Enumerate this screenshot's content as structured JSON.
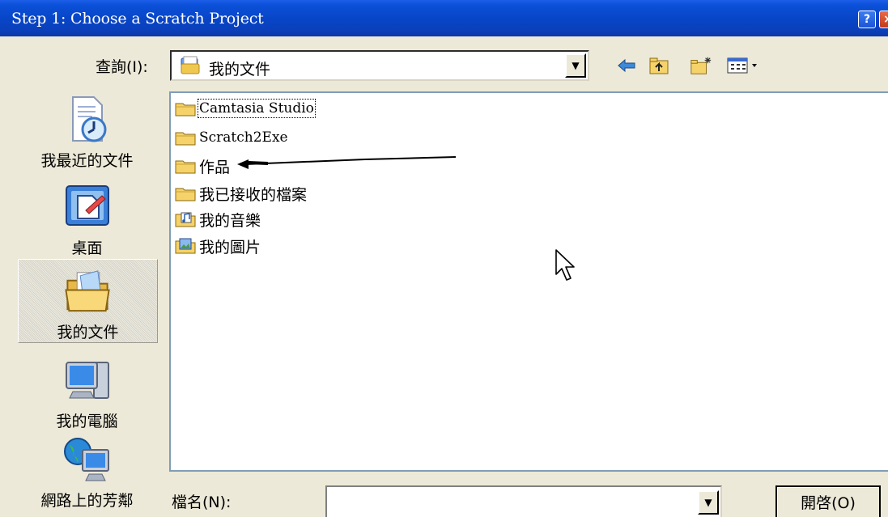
{
  "window": {
    "title": "Step 1: Choose a Scratch Project",
    "help_label": "?",
    "close_label": "×"
  },
  "lookin": {
    "label": "查詢(I):",
    "value": "我的文件",
    "icons": [
      "back-icon",
      "up-folder-icon",
      "new-folder-icon",
      "view-menu-icon"
    ]
  },
  "places": [
    {
      "label": "我最近的文件",
      "icon": "recent-documents-icon"
    },
    {
      "label": "桌面",
      "icon": "desktop-icon"
    },
    {
      "label": "我的文件",
      "icon": "my-documents-icon",
      "selected": true
    },
    {
      "label": "我的電腦",
      "icon": "my-computer-icon"
    },
    {
      "label": "網路上的芳鄰",
      "icon": "network-places-icon"
    }
  ],
  "files": [
    {
      "name": "Camtasia Studio",
      "icon": "folder-icon"
    },
    {
      "name": "Scratch2Exe",
      "icon": "folder-icon"
    },
    {
      "name": "作品",
      "icon": "folder-icon"
    },
    {
      "name": "我已接收的檔案",
      "icon": "folder-icon"
    },
    {
      "name": "我的音樂",
      "icon": "music-folder-icon"
    },
    {
      "name": "我的圖片",
      "icon": "pictures-folder-icon"
    }
  ],
  "filename": {
    "label": "檔名(N):",
    "value": ""
  },
  "open_button": "開啓(O)",
  "colors": {
    "titlebar": "#0a50d8",
    "dialog_bg": "#ece9d8",
    "list_border": "#7f9db9",
    "folder_yellow": "#f5d36a"
  }
}
